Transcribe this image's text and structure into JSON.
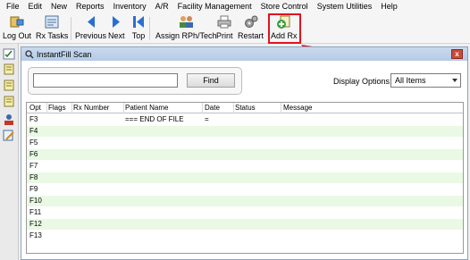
{
  "menu": [
    "File",
    "Edit",
    "New",
    "Reports",
    "Inventory",
    "A/R",
    "Facility Management",
    "Store Control",
    "System Utilities",
    "Help"
  ],
  "toolbar": {
    "logout": "Log Out",
    "rxtasks": "Rx Tasks",
    "previous": "Previous",
    "next": "Next",
    "top": "Top",
    "assign": "Assign RPh/Tech",
    "print": "Print",
    "restart": "Restart",
    "addrx": "Add Rx"
  },
  "window": {
    "title": "InstantFill Scan",
    "close_label": "x",
    "scan_value": "",
    "find_label": "Find",
    "display_options_label": "Display Options:",
    "display_options_value": "All Items"
  },
  "grid": {
    "columns": [
      "Opt",
      "Flags",
      "Rx Number",
      "Patient Name",
      "Date",
      "Status",
      "Message"
    ],
    "rows": [
      {
        "opt": "F3",
        "patient": "=== END OF FILE",
        "date": "="
      },
      {
        "opt": "F4"
      },
      {
        "opt": "F5"
      },
      {
        "opt": "F6"
      },
      {
        "opt": "F7"
      },
      {
        "opt": "F8"
      },
      {
        "opt": "F9"
      },
      {
        "opt": "F10"
      },
      {
        "opt": "F11"
      },
      {
        "opt": "F12"
      },
      {
        "opt": "F13"
      }
    ]
  },
  "colors": {
    "highlight": "#e0141e",
    "alt_row": "#e9f9e4",
    "title_bar": "#c0d4ec"
  }
}
